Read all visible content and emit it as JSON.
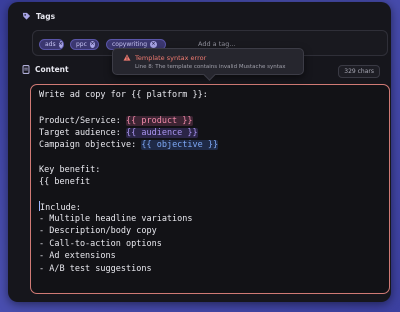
{
  "tags_section": {
    "label": "Tags",
    "chips": [
      "ads",
      "ppc",
      "copywriting"
    ],
    "input_placeholder": "Add a tag..."
  },
  "content_section": {
    "label": "Content",
    "char_count": "329 chars"
  },
  "tooltip": {
    "title": "Template syntax error",
    "message": "Line 8: The template contains invalid Mustache syntax"
  },
  "editor": {
    "line1": "Write ad copy for {{ platform }}:",
    "line3_label": "Product/Service: ",
    "line3_var": "{{ product }}",
    "line4_label": "Target audience: ",
    "line4_var": "{{ audience }}",
    "line5_label": "Campaign objective: ",
    "line5_var": "{{ objective }}",
    "line7": "Key benefit:",
    "line8": "{{ benefit",
    "line10": "Include:",
    "line11": "- Multiple headline variations",
    "line12": "- Description/body copy",
    "line13": "- Call-to-action options",
    "line14": "- Ad extensions",
    "line15": "- A/B test suggestions"
  },
  "colors": {
    "error": "#f07a70",
    "chip_bg": "#3b3770",
    "editor_border": "#d07a75"
  }
}
